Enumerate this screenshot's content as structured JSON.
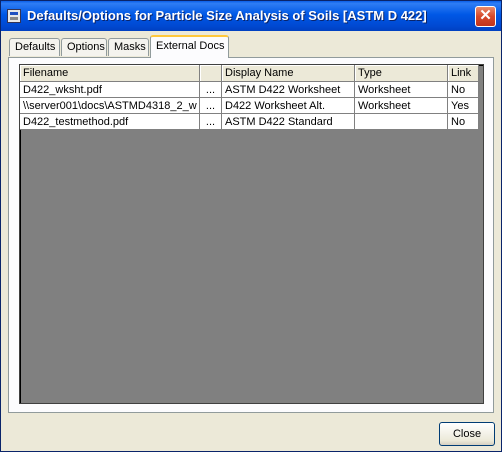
{
  "window": {
    "title": "Defaults/Options for Particle Size Analysis of Soils [ASTM D 422]",
    "close_glyph": "✕"
  },
  "tabs": [
    {
      "label": "Defaults"
    },
    {
      "label": "Options"
    },
    {
      "label": "Masks"
    },
    {
      "label": "External Docs",
      "active": true
    }
  ],
  "grid": {
    "columns": [
      "Filename",
      "",
      "Display Name",
      "Type",
      "Link"
    ],
    "rows": [
      {
        "filename": "D422_wksht.pdf",
        "browse": "...",
        "display_name": "ASTM D422 Worksheet",
        "type": "Worksheet",
        "link": "No"
      },
      {
        "filename": "\\\\server001\\docs\\ASTMD4318_2_w",
        "browse": "...",
        "display_name": "D422 Worksheet Alt.",
        "type": "Worksheet",
        "link": "Yes"
      },
      {
        "filename": "D422_testmethod.pdf",
        "browse": "...",
        "display_name": "ASTM D422 Standard",
        "type": "",
        "link": "No"
      }
    ]
  },
  "buttons": {
    "close_label": "Close"
  }
}
